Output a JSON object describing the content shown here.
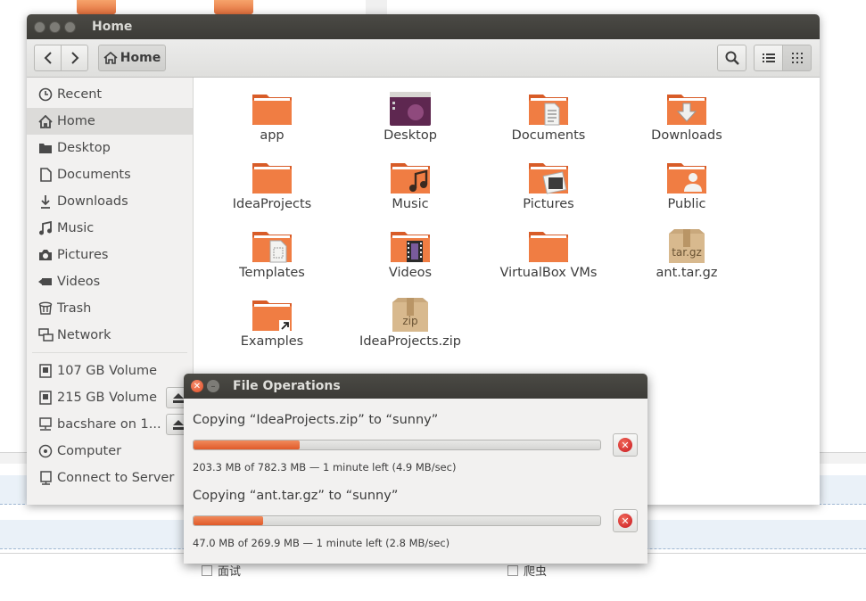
{
  "background": {
    "checkbox_left_label": "面试",
    "checkbox_right_label": "爬虫"
  },
  "window": {
    "title": "Home",
    "path_button": "Home",
    "back_icon": "chevron-left-icon",
    "forward_icon": "chevron-right-icon",
    "search_icon": "search-icon",
    "list_view_icon": "list-view-icon",
    "grid_view_icon": "grid-view-icon"
  },
  "sidebar": {
    "places": [
      {
        "label": "Recent",
        "icon": "clock-icon"
      },
      {
        "label": "Home",
        "icon": "home-icon",
        "active": true
      },
      {
        "label": "Desktop",
        "icon": "folder-icon"
      },
      {
        "label": "Documents",
        "icon": "document-icon"
      },
      {
        "label": "Downloads",
        "icon": "download-icon"
      },
      {
        "label": "Music",
        "icon": "music-icon"
      },
      {
        "label": "Pictures",
        "icon": "camera-icon"
      },
      {
        "label": "Videos",
        "icon": "video-icon"
      },
      {
        "label": "Trash",
        "icon": "trash-icon"
      },
      {
        "label": "Network",
        "icon": "network-icon"
      }
    ],
    "devices": [
      {
        "label": "107 GB Volume",
        "icon": "drive-icon",
        "eject": false
      },
      {
        "label": "215 GB Volume",
        "icon": "drive-icon",
        "eject": true
      },
      {
        "label": "bacshare on 1...",
        "icon": "network-share-icon",
        "eject": true
      },
      {
        "label": "Computer",
        "icon": "computer-icon",
        "eject": false
      },
      {
        "label": "Connect to Server",
        "icon": "server-icon",
        "eject": false
      }
    ]
  },
  "files": [
    {
      "label": "app",
      "kind": "folder"
    },
    {
      "label": "Desktop",
      "kind": "desktop"
    },
    {
      "label": "Documents",
      "kind": "folder-documents"
    },
    {
      "label": "Downloads",
      "kind": "folder-downloads"
    },
    {
      "label": "IdeaProjects",
      "kind": "folder"
    },
    {
      "label": "Music",
      "kind": "folder-music"
    },
    {
      "label": "Pictures",
      "kind": "folder-pictures"
    },
    {
      "label": "Public",
      "kind": "folder-public"
    },
    {
      "label": "Templates",
      "kind": "folder-templates"
    },
    {
      "label": "Videos",
      "kind": "folder-videos"
    },
    {
      "label": "VirtualBox VMs",
      "kind": "folder"
    },
    {
      "label": "ant.tar.gz",
      "kind": "archive",
      "badge": "tar.gz"
    },
    {
      "label": "Examples",
      "kind": "folder-link"
    },
    {
      "label": "IdeaProjects.zip",
      "kind": "archive",
      "badge": "zip"
    }
  ],
  "dialog": {
    "title": "File Operations",
    "operations": [
      {
        "title": "Copying “IdeaProjects.zip” to “sunny”",
        "progress": 0.26,
        "detail": "203.3 MB of 782.3 MB — 1 minute left (4.9 MB/sec)"
      },
      {
        "title": "Copying “ant.tar.gz” to “sunny”",
        "progress": 0.17,
        "detail": "47.0 MB of 269.9 MB — 1 minute left (2.8 MB/sec)"
      }
    ]
  },
  "colors": {
    "accent": "#e05a2a",
    "titlebar": "#3c3b37",
    "folder": "#ef7d43"
  }
}
